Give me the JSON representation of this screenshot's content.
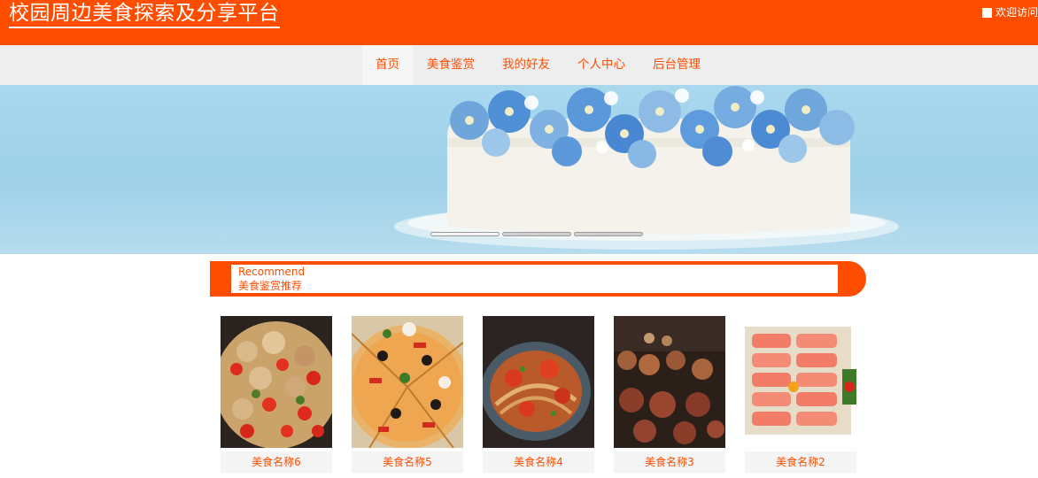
{
  "header": {
    "title": "校园周边美食探索及分享平台",
    "welcome": "欢迎访问"
  },
  "nav": {
    "items": [
      {
        "label": "首页",
        "active": true
      },
      {
        "label": "美食鉴赏",
        "active": false
      },
      {
        "label": "我的好友",
        "active": false
      },
      {
        "label": "个人中心",
        "active": false
      },
      {
        "label": "后台管理",
        "active": false
      }
    ]
  },
  "slider": {
    "dot_count": 3,
    "active_index": 0
  },
  "recommend": {
    "title_en": "Recommend",
    "title_cn": "美食鉴赏推荐"
  },
  "foods": [
    {
      "name": "美食名称6",
      "image": "crayfish-pot-photo"
    },
    {
      "name": "美食名称5",
      "image": "pizza-photo"
    },
    {
      "name": "美食名称4",
      "image": "crab-pot-photo"
    },
    {
      "name": "美食名称3",
      "image": "barbecue-skewers-photo"
    },
    {
      "name": "美食名称2",
      "image": "salmon-sashimi-photo"
    }
  ],
  "colors": {
    "brand": "#ff4d00",
    "nav_bg": "#eeeeee",
    "card_label_bg": "#f4f4f4"
  }
}
